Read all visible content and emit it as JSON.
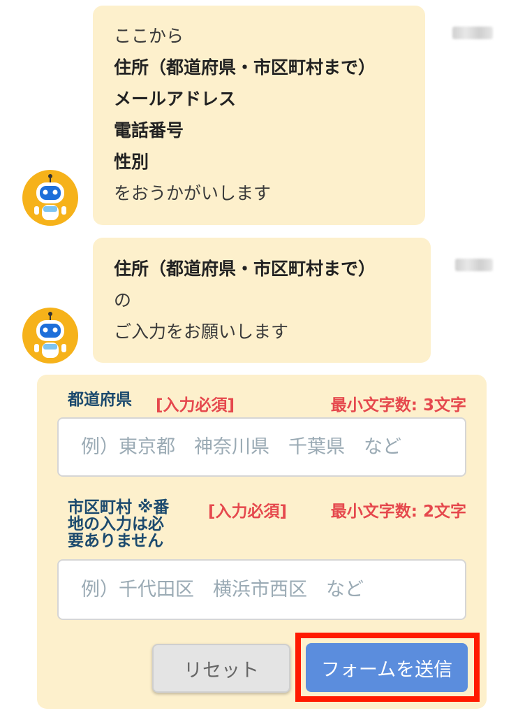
{
  "messages": [
    {
      "lines": [
        {
          "text": "ここから",
          "bold": false
        },
        {
          "text": "住所（都道府県・市区町村まで）",
          "bold": true
        },
        {
          "text": "メールアドレス",
          "bold": true
        },
        {
          "text": "電話番号",
          "bold": true
        },
        {
          "text": "性別",
          "bold": true
        },
        {
          "text": "をおうかがいします",
          "bold": false
        }
      ]
    },
    {
      "lines": [
        {
          "text": "住所（都道府県・市区町村まで）",
          "bold": true
        },
        {
          "text": "の",
          "bold": false
        },
        {
          "text": "ご入力をお願いします",
          "bold": false
        }
      ]
    }
  ],
  "form": {
    "prefecture": {
      "label": "都道府県",
      "required": "[入力必須]",
      "min_chars": "最小文字数: 3文字",
      "placeholder": "例）東京都　神奈川県　千葉県　など",
      "value": ""
    },
    "city": {
      "label_lines": [
        "市区町村 ※番",
        "地の入力は必",
        "要ありません"
      ],
      "required": "[入力必須]",
      "min_chars": "最小文字数: 2文字",
      "placeholder": "例）千代田区　横浜市西区　など",
      "value": ""
    },
    "reset_label": "リセット",
    "submit_label": "フォームを送信"
  },
  "colors": {
    "bubble": "#fdf0cc",
    "label": "#1c4a6e",
    "required": "#e5484d",
    "submit": "#5b8ddd",
    "highlight": "#ff1a00",
    "avatar": "#f6b21a"
  },
  "icons": [
    "robot-avatar-icon"
  ]
}
